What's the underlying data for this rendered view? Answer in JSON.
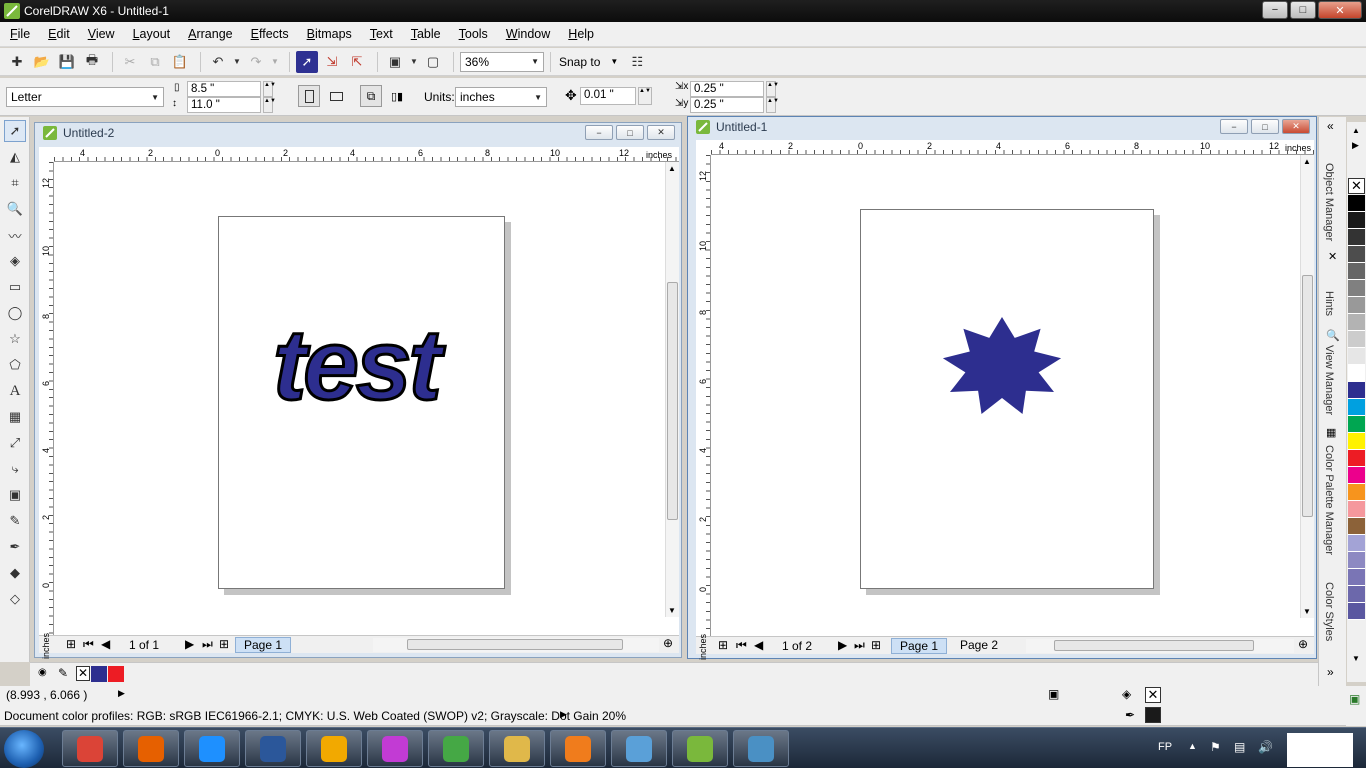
{
  "window": {
    "title": "CorelDRAW X6 - Untitled-1",
    "min_glyph": "−",
    "max_glyph": "□",
    "close_glyph": "✕"
  },
  "menu": [
    "File",
    "Edit",
    "View",
    "Layout",
    "Arrange",
    "Effects",
    "Bitmaps",
    "Text",
    "Table",
    "Tools",
    "Window",
    "Help"
  ],
  "toolbar": {
    "zoom": "36%",
    "snap_to": "Snap to"
  },
  "property_bar": {
    "paper_size": "Letter",
    "width": "8.5 \"",
    "height": "11.0 \"",
    "units_label": "Units:",
    "units_value": "inches",
    "nudge": "0.01 \"",
    "dup_x": "0.25 \"",
    "dup_y": "0.25 \""
  },
  "doc_left": {
    "title": "Untitled-2",
    "ruler_unit": "inches",
    "hruler_labels": [
      "4",
      "2",
      "0",
      "2",
      "4",
      "6",
      "8",
      "10",
      "12"
    ],
    "vruler_labels": [
      "12",
      "10",
      "8",
      "6",
      "4",
      "2",
      "0"
    ],
    "page_counter": "1 of 1",
    "page_tabs": [
      "Page 1"
    ],
    "artwork_text": "test",
    "artwork_color": "#2d2e8f"
  },
  "doc_right": {
    "title": "Untitled-1",
    "ruler_unit": "inches",
    "hruler_labels": [
      "4",
      "2",
      "0",
      "2",
      "4",
      "6",
      "8",
      "10",
      "12"
    ],
    "vruler_labels": [
      "12",
      "10",
      "8",
      "6",
      "4",
      "2",
      "0"
    ],
    "page_counter": "1 of 2",
    "page_tabs": [
      "Page 1",
      "Page 2"
    ],
    "artwork_color": "#2d2e8f"
  },
  "dockers": [
    "Object Manager",
    "Hints",
    "View Manager",
    "Color Palette Manager",
    "Color Styles"
  ],
  "palette_colors": [
    "#000000",
    "#1a1a1a",
    "#333333",
    "#4d4d4d",
    "#666666",
    "#808080",
    "#999999",
    "#b3b3b3",
    "#cccccc",
    "#e6e6e6",
    "#ffffff",
    "#2d2e8f",
    "#00a0e0",
    "#00a651",
    "#fff200",
    "#ed1c24",
    "#ec008c",
    "#f7941d",
    "#f5989d",
    "#8c6239",
    "#a3a3d6",
    "#8d89c2",
    "#7a75b5",
    "#6c68ab",
    "#5a57a0"
  ],
  "document_palette": [
    "#2d2e8f",
    "#ed1c24"
  ],
  "status": {
    "coordinates": "(8.993 , 6.066 )",
    "profiles": "Document color profiles: RGB: sRGB IEC61966-2.1; CMYK: U.S. Web Coated (SWOP) v2; Grayscale: Dot Gain 20%"
  },
  "taskbar": {
    "apps": [
      "Chrome",
      "Firefox",
      "Internet Explorer",
      "Word",
      "Outlook",
      "Paint",
      "Messenger",
      "Explorer",
      "Media Player",
      "Notepad",
      "CorelDRAW",
      "Paint Shop"
    ],
    "language": "FP"
  }
}
